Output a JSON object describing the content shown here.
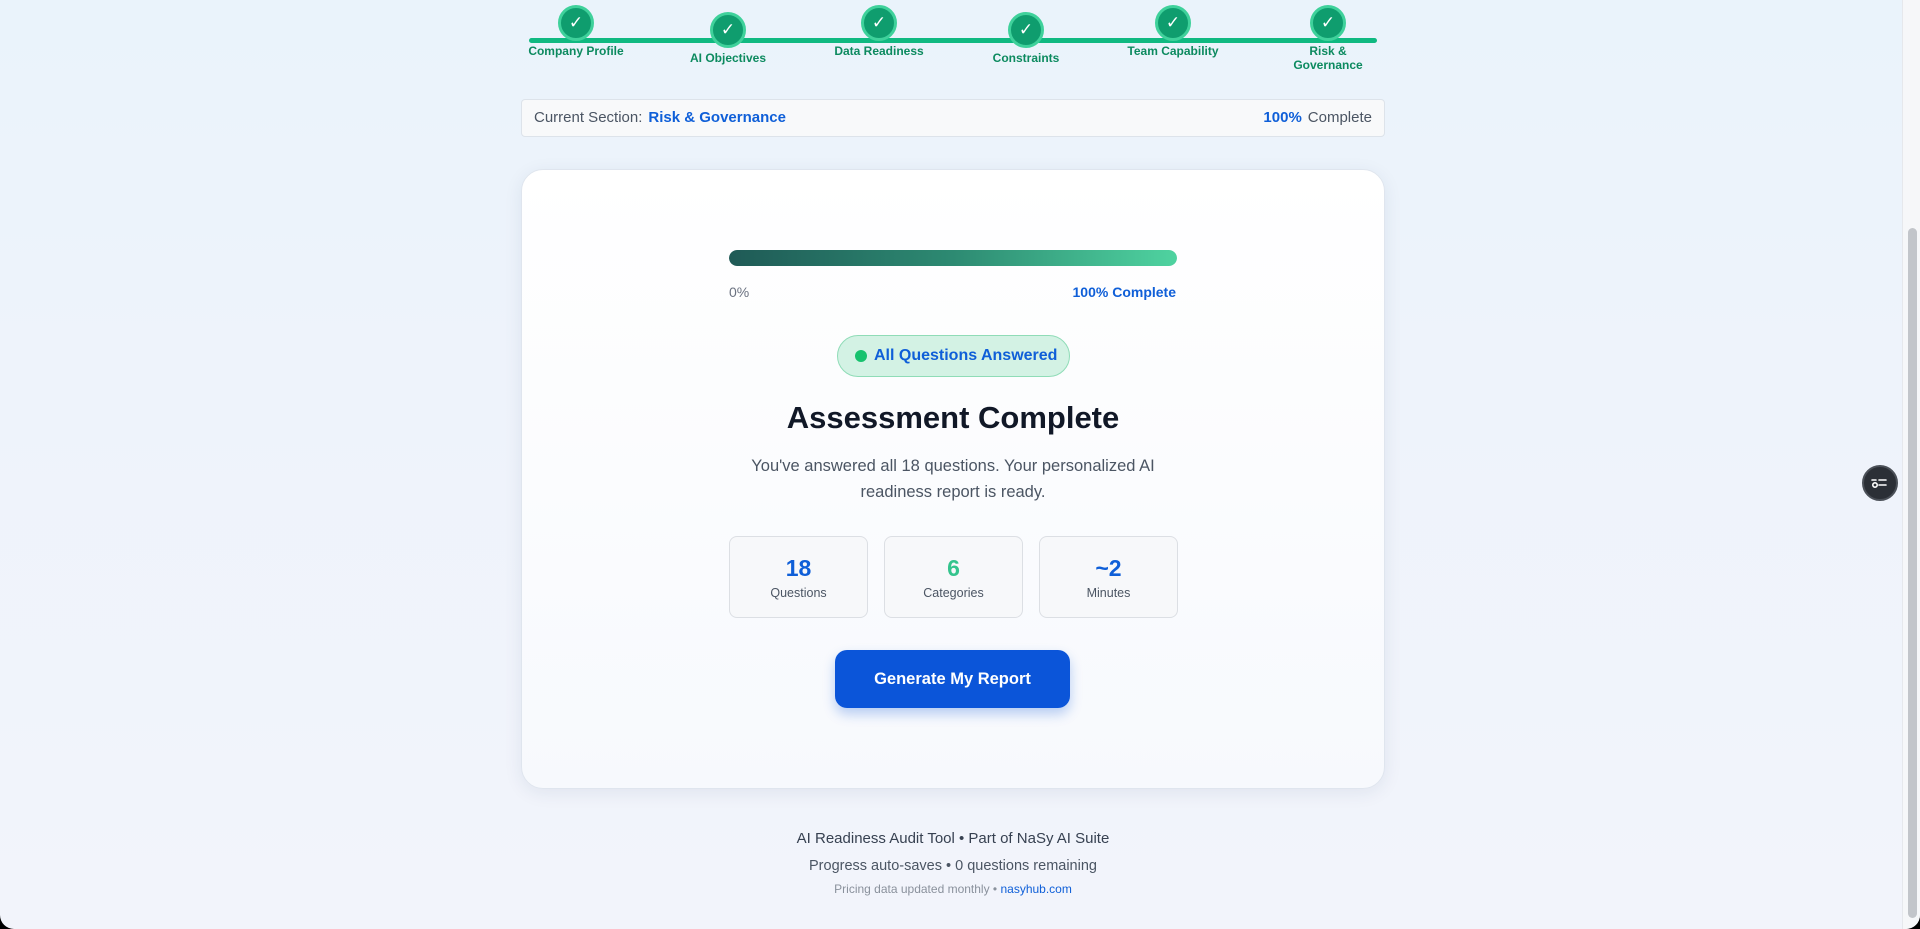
{
  "stepper": {
    "steps": [
      {
        "label": "Company Profile",
        "done": true
      },
      {
        "label": "AI Objectives",
        "done": true
      },
      {
        "label": "Data Readiness",
        "done": true
      },
      {
        "label": "Constraints",
        "done": true
      },
      {
        "label": "Team Capability",
        "done": true
      },
      {
        "label": "Risk & Governance",
        "done": true
      }
    ],
    "check_glyph": "✓"
  },
  "section_bar": {
    "label": "Current Section:",
    "current": "Risk & Governance",
    "percent": "100%",
    "complete_label": "Complete"
  },
  "card": {
    "progress": {
      "value": 1.0,
      "left_label": "0%",
      "right_label": "100% Complete"
    },
    "badge": "All Questions Answered",
    "title": "Assessment Complete",
    "description": "You've answered all 18 questions. Your personalized AI readiness report is ready.",
    "stats": [
      {
        "value": "18",
        "label": "Questions"
      },
      {
        "value": "6",
        "label": "Categories"
      },
      {
        "value": "~2",
        "label": "Minutes"
      }
    ],
    "cta_label": "Generate My Report"
  },
  "footer": {
    "line1": "AI Readiness Audit Tool • Part of NaSy AI Suite",
    "line2": "Progress auto-saves • 0 questions remaining",
    "line3_text": "Pricing data updated monthly • ",
    "line3_link": "nasyhub.com"
  },
  "colors": {
    "accent": "#0b55d9",
    "success": "#10b981",
    "step_fill": "#0f9d6e"
  },
  "icons": {
    "floating_widget": "settings-list-icon",
    "step": "check-icon"
  }
}
